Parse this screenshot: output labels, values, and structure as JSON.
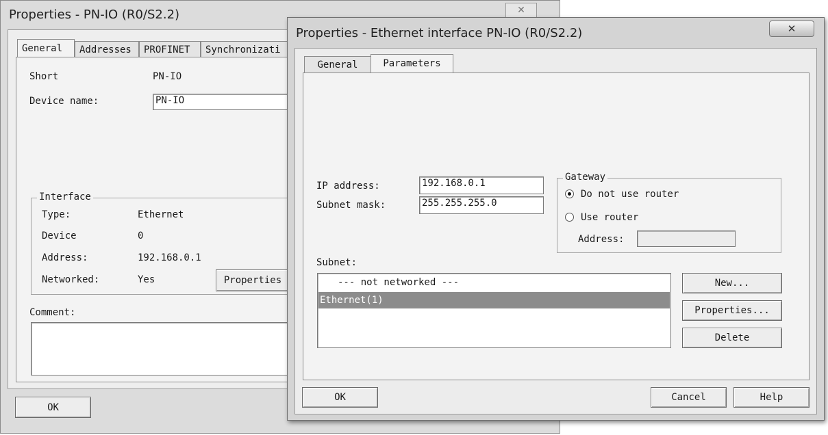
{
  "back_window": {
    "title": "Properties - PN-IO (R0/S2.2)",
    "tabs": [
      "General",
      "Addresses",
      "PROFINET",
      "Synchronizati"
    ],
    "short_label": "Short",
    "short_value": "PN-IO",
    "device_name_label": "Device name:",
    "device_name_value": "PN-IO",
    "interface": {
      "legend": "Interface",
      "type_label": "Type:",
      "type_value": "Ethernet",
      "device_label": "Device",
      "device_value": "0",
      "address_label": "Address:",
      "address_value": "192.168.0.1",
      "networked_label": "Networked:",
      "networked_value": "Yes",
      "properties_button": "Properties"
    },
    "comment_label": "Comment:",
    "comment_value": "",
    "ok_button": "OK",
    "close_glyph": "✕"
  },
  "front_window": {
    "title": "Properties - Ethernet interface  PN-IO (R0/S2.2)",
    "close_glyph": "✕",
    "tabs": [
      "General",
      "Parameters"
    ],
    "active_tab": "Parameters",
    "ip_label": "IP address:",
    "ip_value": "192.168.0.1",
    "subnet_mask_label": "Subnet mask:",
    "subnet_mask_value": "255.255.255.0",
    "gateway": {
      "legend": "Gateway",
      "option_no_router": "Do not use router",
      "option_use_router": "Use router",
      "selected": "Do not use router",
      "address_label": "Address:",
      "address_value": ""
    },
    "subnet_label": "Subnet:",
    "subnet_items": [
      "--- not networked ---",
      "Ethernet(1)"
    ],
    "selected_subnet": "Ethernet(1)",
    "new_button": "New...",
    "properties_button": "Properties...",
    "delete_button": "Delete",
    "ok_button": "OK",
    "cancel_button": "Cancel",
    "help_button": "Help"
  },
  "colors": {
    "window_bg": "#d4d4d4",
    "panel_bg": "#f3f3f3",
    "selection_bg": "#8c8c8c",
    "selection_fg": "#ffffff"
  }
}
